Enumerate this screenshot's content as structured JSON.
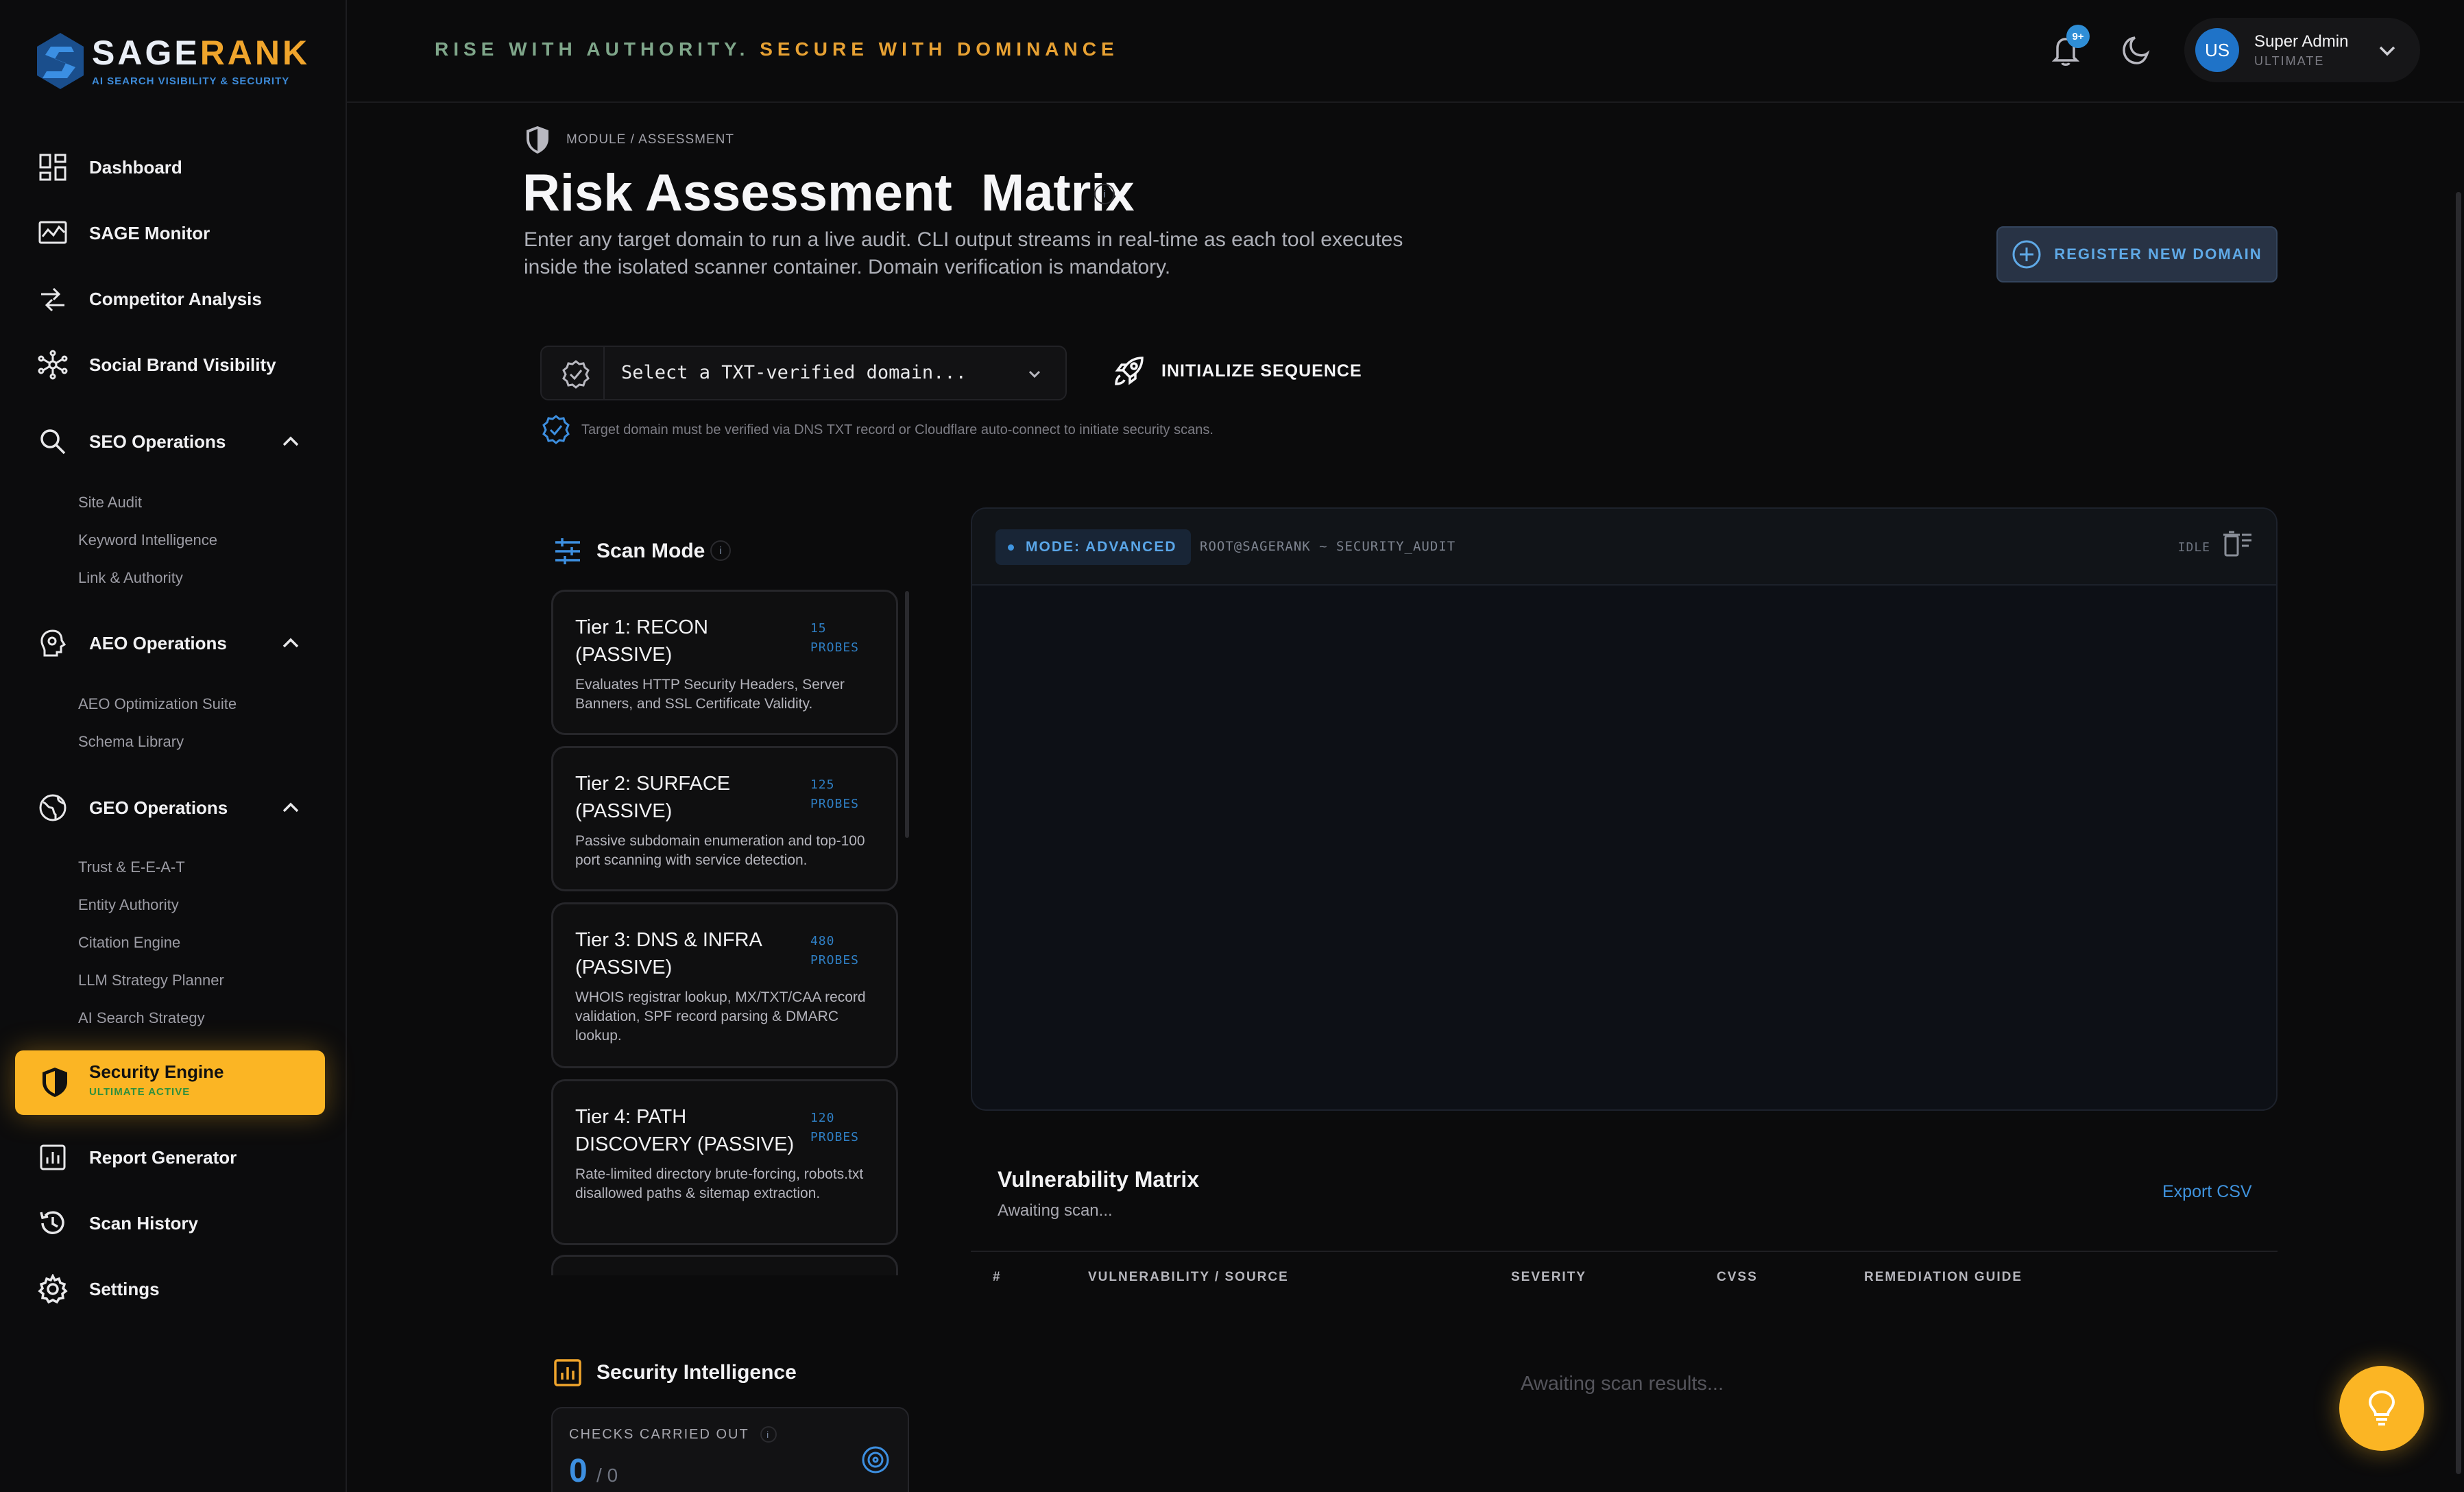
{
  "brand": {
    "name_main": "SAGE",
    "name_accent": "RANK",
    "tagline": "AI SEARCH VISIBILITY & SECURITY"
  },
  "header": {
    "tagline_part1": "RISE WITH AUTHORITY.",
    "tagline_part2": "SECURE WITH DOMINANCE",
    "notification_badge": "9+",
    "user": {
      "initials": "US",
      "name": "Super Admin",
      "plan": "ULTIMATE"
    }
  },
  "sidebar": {
    "items": [
      {
        "label": "Dashboard",
        "icon": "grid-icon"
      },
      {
        "label": "SAGE Monitor",
        "icon": "chart-monitor-icon"
      },
      {
        "label": "Competitor Analysis",
        "icon": "arrows-compare-icon"
      },
      {
        "label": "Social Brand Visibility",
        "icon": "network-icon"
      }
    ],
    "groups": [
      {
        "label": "SEO Operations",
        "icon": "search-icon",
        "subitems": [
          "Site Audit",
          "Keyword Intelligence",
          "Link & Authority"
        ]
      },
      {
        "label": "AEO Operations",
        "icon": "brain-gear-icon",
        "subitems": [
          "AEO Optimization Suite",
          "Schema Library"
        ]
      },
      {
        "label": "GEO Operations",
        "icon": "globe-icon",
        "subitems": [
          "Trust & E-E-A-T",
          "Entity Authority",
          "Citation Engine",
          "LLM Strategy Planner",
          "AI Search Strategy"
        ]
      }
    ],
    "active": {
      "label": "Security Engine",
      "sublabel": "ULTIMATE ACTIVE",
      "icon": "shield-icon"
    },
    "bottom_items": [
      {
        "label": "Report Generator",
        "icon": "report-icon"
      },
      {
        "label": "Scan History",
        "icon": "history-icon"
      },
      {
        "label": "Settings",
        "icon": "gear-icon"
      }
    ]
  },
  "main": {
    "breadcrumb": "MODULE / ASSESSMENT",
    "title": "Risk Assessment  Matrix",
    "info": "i",
    "description": "Enter any target domain to run a live audit. CLI output streams in real-time as each tool executes inside the isolated scanner container. Domain verification is mandatory.",
    "register_button": "REGISTER NEW DOMAIN",
    "domain_select": {
      "placeholder": "Select a TXT-verified domain..."
    },
    "initialize_button": "INITIALIZE SEQUENCE",
    "verify_note": "Target domain must be verified via DNS TXT record or Cloudflare auto-connect to initiate security scans."
  },
  "scan_mode": {
    "title": "Scan Mode",
    "tiers": [
      {
        "name": "Tier 1: RECON (PASSIVE)",
        "probes": "15",
        "probes_label": "PROBES",
        "desc": "Evaluates HTTP Security Headers, Server Banners, and SSL Certificate Validity."
      },
      {
        "name": "Tier 2: SURFACE (PASSIVE)",
        "probes": "125",
        "probes_label": "PROBES",
        "desc": "Passive subdomain enumeration and top-100 port scanning with service detection."
      },
      {
        "name": "Tier 3: DNS & INFRA (PASSIVE)",
        "probes": "480",
        "probes_label": "PROBES",
        "desc": "WHOIS registrar lookup, MX/TXT/CAA record validation, SPF record parsing & DMARC lookup."
      },
      {
        "name": "Tier 4: PATH DISCOVERY (PASSIVE)",
        "probes": "120",
        "probes_label": "PROBES",
        "desc": "Rate-limited directory brute-forcing, robots.txt disallowed paths & sitemap extraction."
      }
    ]
  },
  "terminal": {
    "mode": "MODE: ADVANCED",
    "path": "ROOT@SAGERANK ~ SECURITY_AUDIT",
    "status": "IDLE"
  },
  "vulnerability_matrix": {
    "title": "Vulnerability Matrix",
    "subtitle": "Awaiting scan...",
    "export": "Export CSV",
    "columns": [
      "#",
      "VULNERABILITY / SOURCE",
      "SEVERITY",
      "CVSS",
      "REMEDIATION GUIDE"
    ],
    "empty": "Awaiting scan results..."
  },
  "security_intelligence": {
    "title": "Security Intelligence",
    "checks_label": "CHECKS CARRIED OUT",
    "checks_done": "0",
    "checks_total": "/ 0"
  },
  "colors": {
    "accent": "#fbb524",
    "blue": "#3d8fe0",
    "background": "#0b0b0c"
  }
}
